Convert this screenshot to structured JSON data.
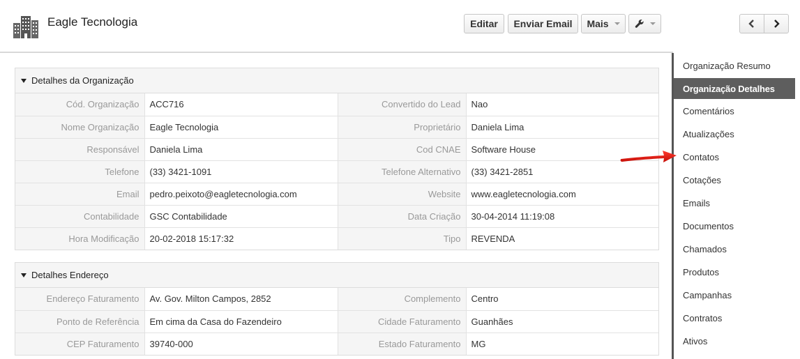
{
  "header": {
    "org_icon": "building-icon",
    "title": "Eagle Tecnologia"
  },
  "toolbar": {
    "edit_label": "Editar",
    "email_label": "Enviar Email",
    "more_label": "Mais",
    "tools_icon": "wrench-icon",
    "prev_icon": "chevron-left-icon",
    "next_icon": "chevron-right-icon"
  },
  "sidebar": {
    "items": [
      {
        "label": "Organização Resumo",
        "active": false
      },
      {
        "label": "Organização Detalhes",
        "active": true
      },
      {
        "label": "Comentários",
        "active": false
      },
      {
        "label": "Atualizações",
        "active": false
      },
      {
        "label": "Contatos",
        "active": false
      },
      {
        "label": "Cotações",
        "active": false
      },
      {
        "label": "Emails",
        "active": false
      },
      {
        "label": "Documentos",
        "active": false
      },
      {
        "label": "Chamados",
        "active": false
      },
      {
        "label": "Produtos",
        "active": false
      },
      {
        "label": "Campanhas",
        "active": false
      },
      {
        "label": "Contratos",
        "active": false
      },
      {
        "label": "Ativos",
        "active": false
      }
    ]
  },
  "org_details": {
    "title": "Detalhes da Organização",
    "rows": [
      [
        {
          "label": "Cód. Organização",
          "value": "ACC716"
        },
        {
          "label": "Convertido do Lead",
          "value": "Nao"
        }
      ],
      [
        {
          "label": "Nome Organização",
          "value": "Eagle Tecnologia"
        },
        {
          "label": "Proprietário",
          "value": "Daniela Lima"
        }
      ],
      [
        {
          "label": "Responsável",
          "value": "Daniela Lima"
        },
        {
          "label": "Cod CNAE",
          "value": "Software House"
        }
      ],
      [
        {
          "label": "Telefone",
          "value": "(33) 3421-1091"
        },
        {
          "label": "Telefone Alternativo",
          "value": "(33) 3421-2851"
        }
      ],
      [
        {
          "label": "Email",
          "value": "pedro.peixoto@eagletecnologia.com"
        },
        {
          "label": "Website",
          "value": "www.eagletecnologia.com"
        }
      ],
      [
        {
          "label": "Contabilidade",
          "value": "GSC Contabilidade"
        },
        {
          "label": "Data Criação",
          "value": "30-04-2014 11:19:08"
        }
      ],
      [
        {
          "label": "Hora Modificação",
          "value": "20-02-2018 15:17:32"
        },
        {
          "label": "Tipo",
          "value": "REVENDA"
        }
      ]
    ]
  },
  "address_details": {
    "title": "Detalhes Endereço",
    "rows": [
      [
        {
          "label": "Endereço Faturamento",
          "value": "Av. Gov. Milton Campos, 2852"
        },
        {
          "label": "Complemento",
          "value": "Centro"
        }
      ],
      [
        {
          "label": "Ponto de Referência",
          "value": "Em cima da Casa do Fazendeiro"
        },
        {
          "label": "Cidade Faturamento",
          "value": "Guanhães"
        }
      ],
      [
        {
          "label": "CEP Faturamento",
          "value": "39740-000"
        },
        {
          "label": "Estado Faturamento",
          "value": "MG"
        }
      ]
    ]
  },
  "annotation": {
    "icon": "red-arrow-icon",
    "color": "#e3120b"
  },
  "colors": {
    "sidebar_active_bg": "#5e5e5e",
    "sidebar_border": "#555555",
    "label_text": "#999999"
  }
}
